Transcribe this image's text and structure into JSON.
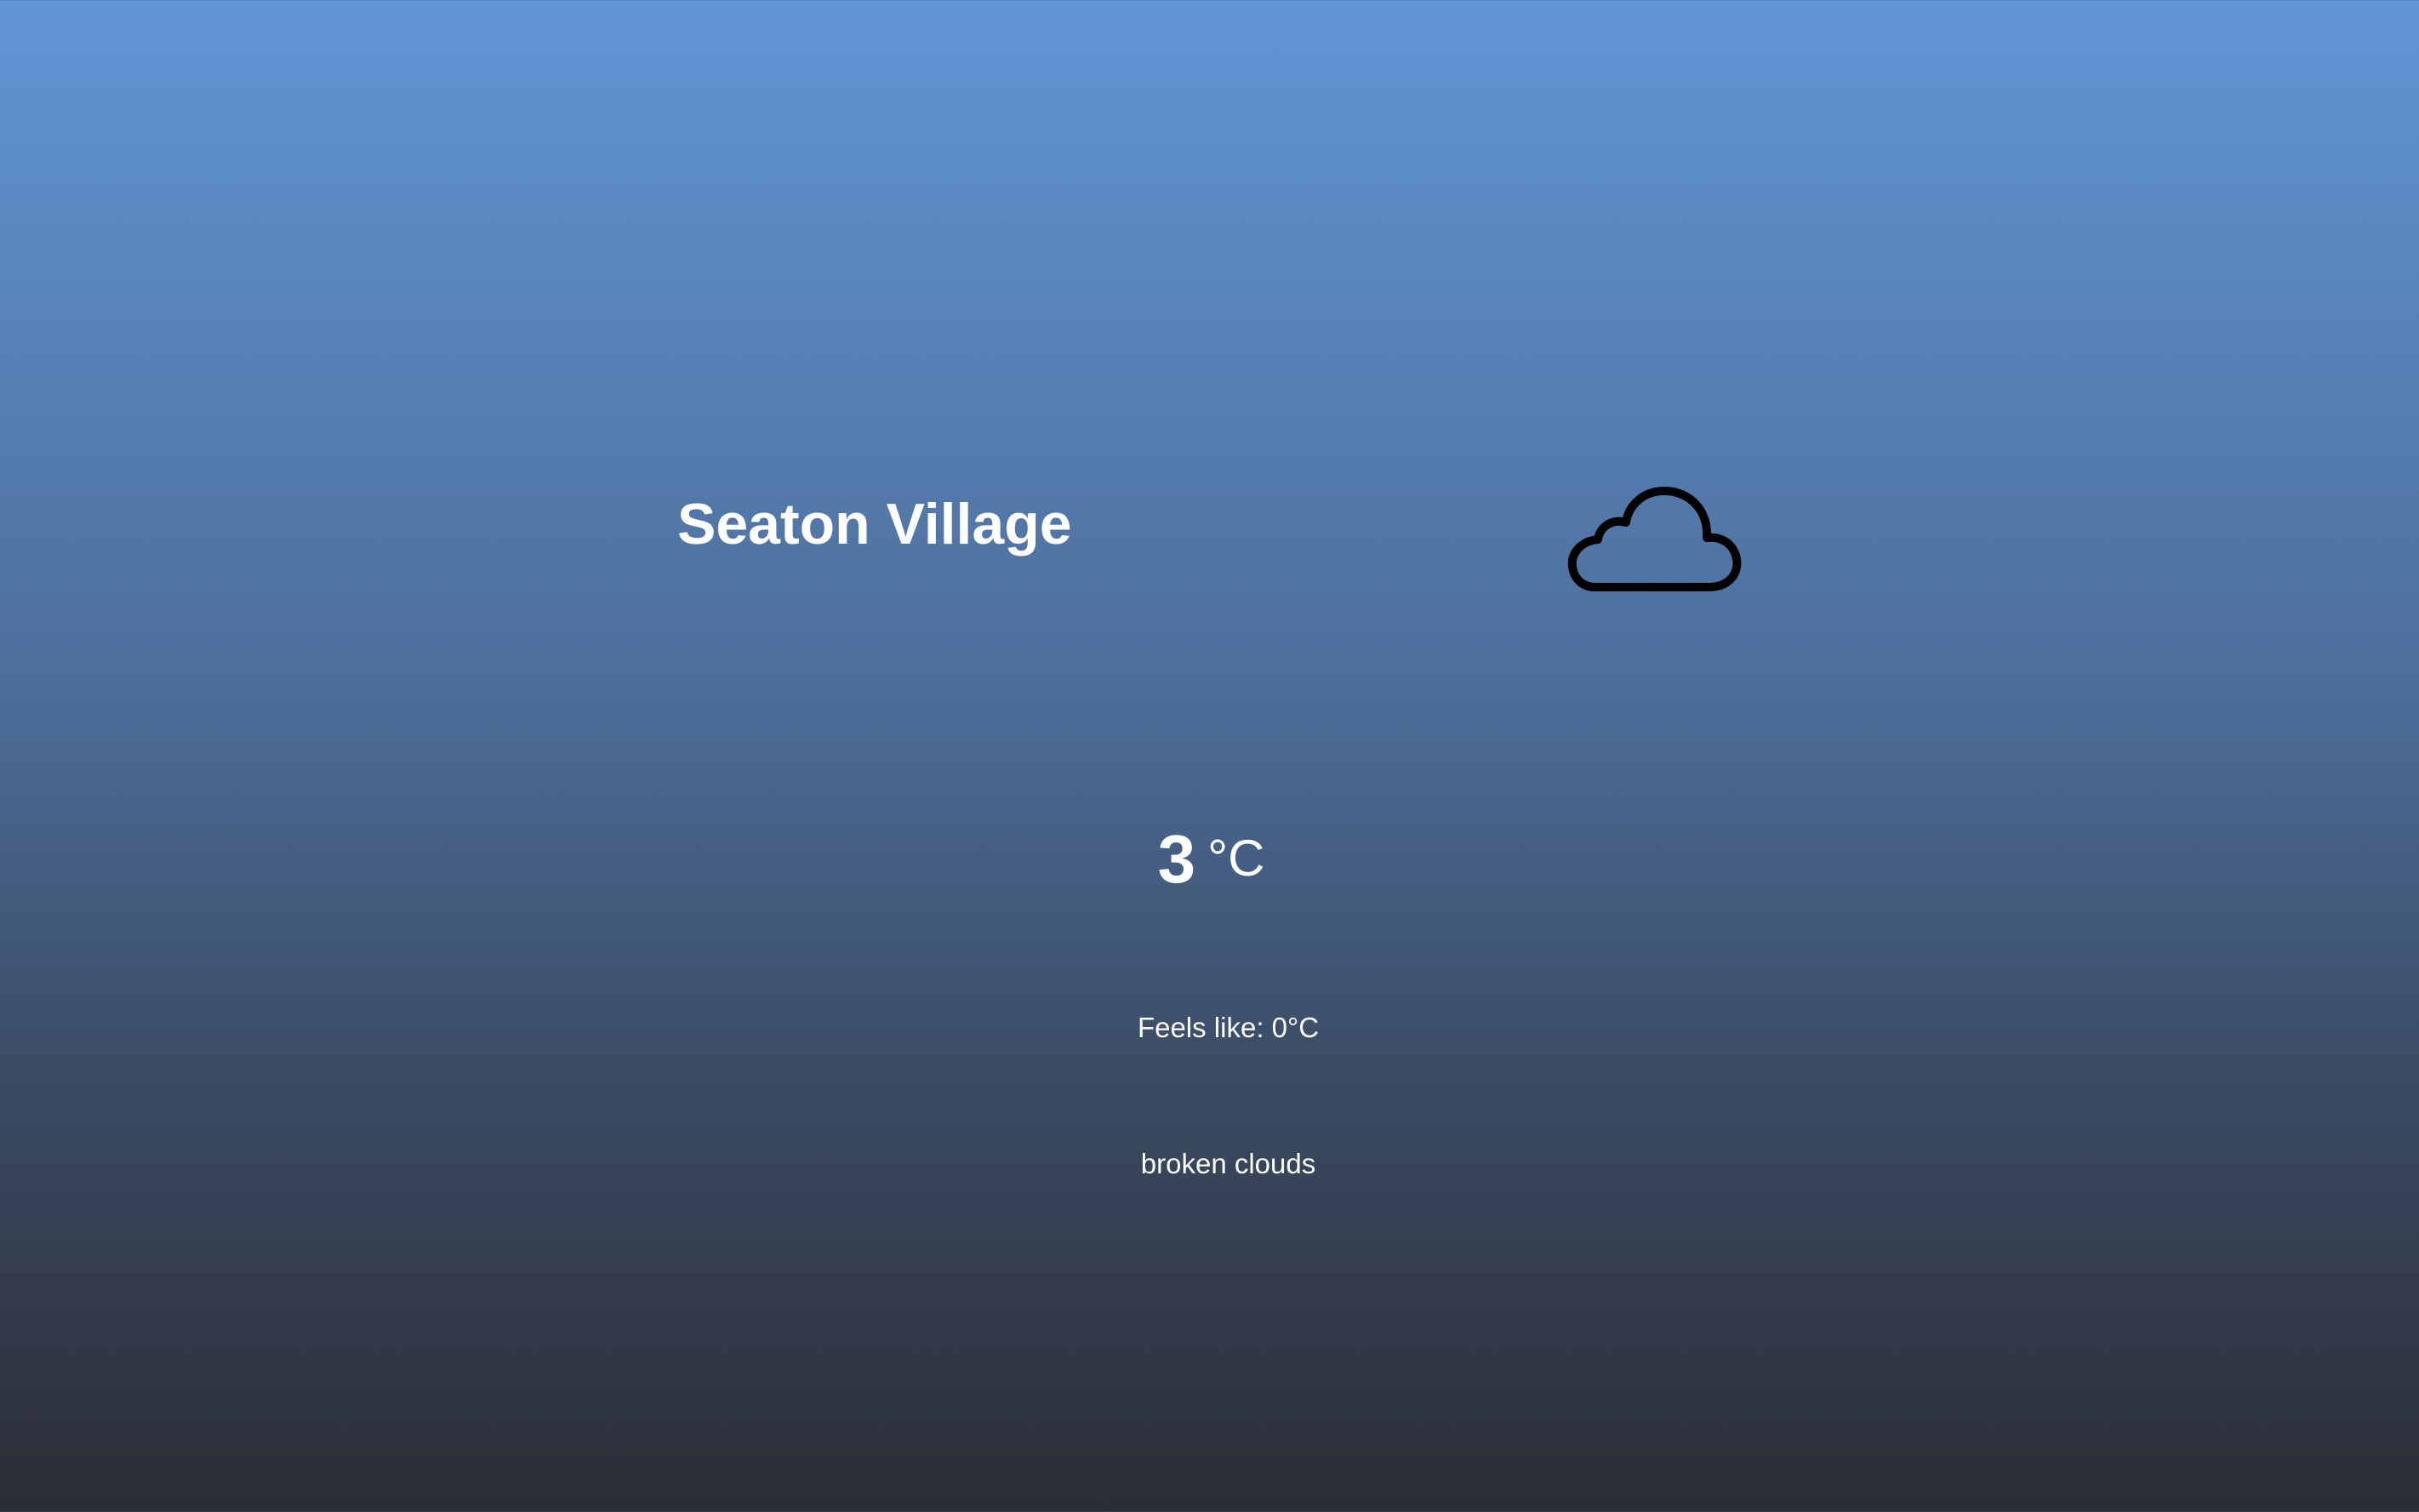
{
  "location": {
    "city": "Seaton Village"
  },
  "current": {
    "temperature": "3",
    "unit": "°C",
    "feels_like": "Feels like: 0°C",
    "description": "broken clouds",
    "icon": "cloud-icon"
  },
  "colors": {
    "gradient_top": "#6196d4",
    "gradient_bottom": "#2b2d36",
    "text": "#ffffff",
    "icon_stroke": "#000000"
  }
}
